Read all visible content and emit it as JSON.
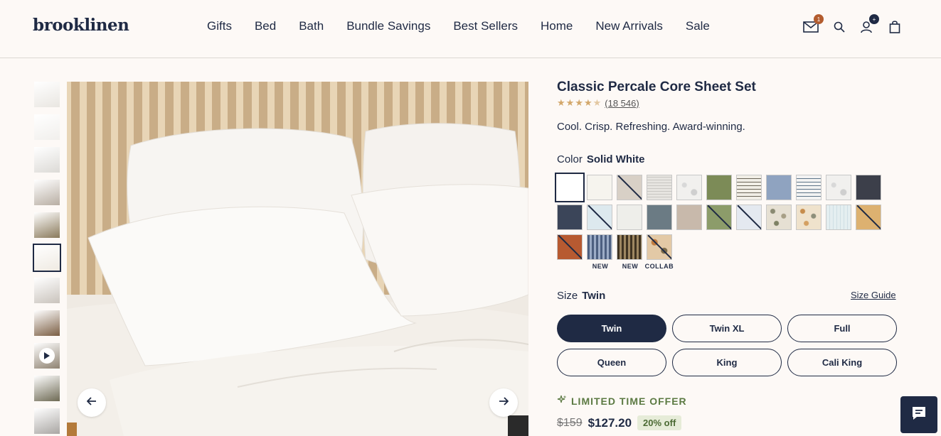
{
  "brand": {
    "logo": "brooklinen"
  },
  "nav": [
    "Gifts",
    "Bed",
    "Bath",
    "Bundle Savings",
    "Best Sellers",
    "Home",
    "New Arrivals",
    "Sale"
  ],
  "header_icons": {
    "mail": {
      "icon": "mail-icon",
      "badge": "1",
      "badge_color": "#b35c2e"
    },
    "search": {
      "icon": "search-icon"
    },
    "account": {
      "icon": "account-icon",
      "badge": "+",
      "badge_color": "#1f2a44"
    },
    "cart": {
      "icon": "bag-icon"
    }
  },
  "gallery": {
    "thumbnails": [
      {
        "kind": "image",
        "color": "#e9e6e1"
      },
      {
        "kind": "image",
        "color": "#f1efec"
      },
      {
        "kind": "image",
        "color": "#dcdad6"
      },
      {
        "kind": "image",
        "color": "#b8aea3"
      },
      {
        "kind": "image",
        "color": "#8a7a5b"
      },
      {
        "kind": "image",
        "color": "#efeae2",
        "active": true
      },
      {
        "kind": "image",
        "color": "#c9c3bc"
      },
      {
        "kind": "image",
        "color": "#7b5e43"
      },
      {
        "kind": "video",
        "color": "#8f8372"
      },
      {
        "kind": "image",
        "color": "#6e6a54"
      },
      {
        "kind": "image",
        "color": "#a9a6a3"
      }
    ],
    "prev_icon": "arrow-left-icon",
    "next_icon": "arrow-right-icon"
  },
  "product": {
    "title": "Classic Percale Core Sheet Set",
    "rating": 4.5,
    "review_count": "(18 546)",
    "tagline": "Cool. Crisp. Refreshing. Award-winning.",
    "color_label": "Color",
    "selected_color": "Solid White",
    "swatches": [
      {
        "color": "#ffffff",
        "selected": true
      },
      {
        "color": "#f6f4ee"
      },
      {
        "color": "#d8d0c6",
        "sold_out": true
      },
      {
        "color": "#e4e2df",
        "pattern": "stripe"
      },
      {
        "color": "#f1f0ee",
        "pattern": "marble"
      },
      {
        "color": "#7c8b57"
      },
      {
        "color": "#f1eee6",
        "pattern": "stripe-dark"
      },
      {
        "color": "#8fa3c0"
      },
      {
        "color": "#f2f2f2",
        "pattern": "stripe-blue"
      },
      {
        "color": "#e3e3e3",
        "pattern": "marble"
      },
      {
        "color": "#3c3f4a"
      },
      {
        "color": "#3b4559"
      },
      {
        "color": "#dde9ee",
        "sold_out": true
      },
      {
        "color": "#eeeeea"
      },
      {
        "color": "#6b7b84"
      },
      {
        "color": "#c8b9ab"
      },
      {
        "color": "#8c9c6a",
        "sold_out": true
      },
      {
        "color": "#e4e9f0",
        "sold_out": true
      },
      {
        "color": "#e6e0d3",
        "pattern": "dots"
      },
      {
        "color": "#efe2cc",
        "pattern": "dots-warm"
      },
      {
        "color": "#e4eef0",
        "pattern": "stripe-light"
      },
      {
        "color": "#ddb170",
        "sold_out": true
      },
      {
        "color": "#b75a31",
        "sold_out": true
      },
      {
        "color": "#7588a6",
        "pattern": "vstripe",
        "tag": "NEW"
      },
      {
        "color": "#6a573d",
        "pattern": "vstripe-dark",
        "tag": "NEW"
      },
      {
        "color": "#e3c9a6",
        "pattern": "leaf",
        "tag": "COLLAB",
        "sold_out": true
      }
    ],
    "size_label": "Size",
    "selected_size": "Twin",
    "size_guide": "Size Guide",
    "sizes": [
      "Twin",
      "Twin XL",
      "Full",
      "Queen",
      "King",
      "Cali King"
    ],
    "offer_label": "LIMITED TIME OFFER",
    "offer_icon": "sparkle-icon",
    "old_price": "$159",
    "price": "$127.20",
    "discount": "20% off"
  },
  "chat": {
    "icon": "chat-icon"
  },
  "colors": {
    "navy": "#1f2a44",
    "accent_green": "#5c7a43",
    "background": "#fdf9f6"
  }
}
